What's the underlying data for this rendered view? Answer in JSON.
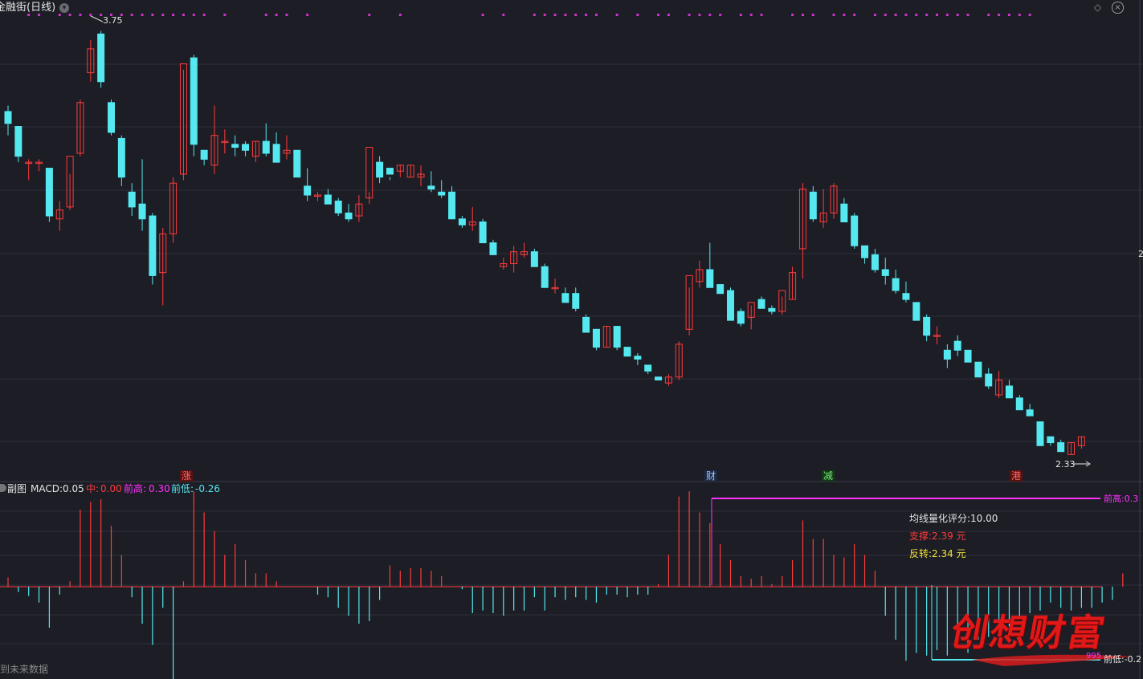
{
  "header": {
    "title": "金融街(日线)",
    "icons": [
      "dropdown-icon",
      "diamond-icon",
      "close-icon"
    ]
  },
  "price_panel": {
    "high_label": "3.75",
    "low_label": "2.33",
    "right_tick": "2",
    "event_tags": [
      {
        "text": "涨",
        "style": "red",
        "bar_index": 17
      },
      {
        "text": "财",
        "style": "blue",
        "bar_index": 68
      },
      {
        "text": "减",
        "style": "green",
        "bar_index": 79
      },
      {
        "text": "港",
        "style": "red",
        "bar_index": 97
      }
    ]
  },
  "sub_panel": {
    "name": "副图",
    "macd_label": "MACD:",
    "macd_value": "0.05",
    "mid_label": "中:",
    "mid_value": "0.00",
    "prev_high_label": "前高:",
    "prev_high_value": "0.30",
    "prev_low_label": "前低:",
    "prev_low_value": "-0.26",
    "score_text": "均线量化评分:10.00",
    "support_text": "支撑:2.39 元",
    "reversal_text": "反转:2.34 元",
    "prev_high_tag": "前高:0.3",
    "prev_low_tag": "前低:-0.2",
    "bottom_small": "995",
    "footer_text": "到未来数据"
  },
  "watermark": "创想财富",
  "colors": {
    "background": "#1c1d25",
    "up": "#ff3b3b",
    "down": "#55e8f0",
    "marker": "#cc33cc",
    "grid": "#2e303a"
  },
  "chart_data": [
    {
      "type": "candlestick",
      "title": "金融街(日线)",
      "ylim": [
        2.28,
        3.8
      ],
      "ohlc": [
        [
          3.48,
          3.5,
          3.4,
          3.44
        ],
        [
          3.43,
          3.43,
          3.31,
          3.33
        ],
        [
          3.31,
          3.32,
          3.25,
          3.31
        ],
        [
          3.31,
          3.32,
          3.28,
          3.31
        ],
        [
          3.29,
          3.29,
          3.11,
          3.13
        ],
        [
          3.12,
          3.18,
          3.08,
          3.15
        ],
        [
          3.16,
          3.27,
          3.15,
          3.33
        ],
        [
          3.34,
          3.52,
          3.33,
          3.51
        ],
        [
          3.61,
          3.72,
          3.58,
          3.69
        ],
        [
          3.74,
          3.75,
          3.56,
          3.58
        ],
        [
          3.51,
          3.52,
          3.4,
          3.41
        ],
        [
          3.39,
          3.4,
          3.23,
          3.26
        ],
        [
          3.21,
          3.24,
          3.13,
          3.16
        ],
        [
          3.17,
          3.32,
          3.08,
          3.12
        ],
        [
          3.13,
          3.14,
          2.9,
          2.93
        ],
        [
          2.94,
          3.09,
          2.83,
          3.07
        ],
        [
          3.07,
          3.26,
          3.04,
          3.24
        ],
        [
          3.27,
          3.62,
          3.25,
          3.64
        ],
        [
          3.66,
          3.67,
          3.33,
          3.37
        ],
        [
          3.35,
          3.35,
          3.3,
          3.32
        ],
        [
          3.3,
          3.5,
          3.27,
          3.4
        ],
        [
          3.38,
          3.42,
          3.34,
          3.38
        ],
        [
          3.37,
          3.4,
          3.33,
          3.36
        ],
        [
          3.37,
          3.38,
          3.33,
          3.35
        ],
        [
          3.33,
          3.38,
          3.31,
          3.38
        ],
        [
          3.38,
          3.44,
          3.33,
          3.34
        ],
        [
          3.37,
          3.41,
          3.31,
          3.31
        ],
        [
          3.34,
          3.4,
          3.32,
          3.35
        ],
        [
          3.35,
          3.35,
          3.28,
          3.26
        ],
        [
          3.23,
          3.29,
          3.18,
          3.2
        ],
        [
          3.2,
          3.21,
          3.18,
          3.2
        ],
        [
          3.2,
          3.22,
          3.17,
          3.17
        ],
        [
          3.18,
          3.19,
          3.13,
          3.14
        ],
        [
          3.14,
          3.17,
          3.11,
          3.12
        ],
        [
          3.13,
          3.2,
          3.11,
          3.17
        ],
        [
          3.19,
          3.21,
          3.17,
          3.36
        ],
        [
          3.31,
          3.33,
          3.24,
          3.26
        ],
        [
          3.29,
          3.26,
          3.25,
          3.27
        ],
        [
          3.28,
          3.3,
          3.26,
          3.3
        ],
        [
          3.26,
          3.3,
          3.26,
          3.3
        ],
        [
          3.26,
          3.3,
          3.23,
          3.27
        ],
        [
          3.23,
          3.28,
          3.21,
          3.22
        ],
        [
          3.21,
          3.25,
          3.19,
          3.2
        ],
        [
          3.21,
          3.23,
          3.15,
          3.12
        ],
        [
          3.12,
          3.13,
          3.09,
          3.1
        ],
        [
          3.1,
          3.16,
          3.08,
          3.11
        ],
        [
          3.11,
          3.12,
          3.06,
          3.04
        ],
        [
          3.04,
          3.05,
          3.01,
          3.0
        ],
        [
          2.96,
          2.99,
          2.95,
          2.97
        ],
        [
          2.97,
          3.03,
          2.94,
          3.01
        ],
        [
          3.0,
          3.04,
          2.99,
          3.01
        ],
        [
          3.01,
          3.02,
          2.96,
          2.96
        ],
        [
          2.96,
          2.97,
          2.9,
          2.89
        ],
        [
          2.89,
          2.92,
          2.87,
          2.89
        ],
        [
          2.87,
          2.89,
          2.86,
          2.84
        ],
        [
          2.87,
          2.89,
          2.81,
          2.82
        ],
        [
          2.79,
          2.8,
          2.75,
          2.74
        ],
        [
          2.75,
          2.75,
          2.68,
          2.69
        ],
        [
          2.69,
          2.76,
          2.69,
          2.76
        ],
        [
          2.76,
          2.76,
          2.68,
          2.69
        ],
        [
          2.69,
          2.69,
          2.67,
          2.66
        ],
        [
          2.66,
          2.67,
          2.63,
          2.65
        ],
        [
          2.63,
          2.63,
          2.6,
          2.61
        ],
        [
          2.59,
          2.59,
          2.58,
          2.58
        ],
        [
          2.57,
          2.6,
          2.56,
          2.59
        ],
        [
          2.59,
          2.71,
          2.58,
          2.7
        ],
        [
          2.75,
          2.89,
          2.73,
          2.93
        ],
        [
          2.91,
          2.98,
          2.89,
          2.95
        ],
        [
          2.95,
          3.04,
          2.89,
          2.89
        ],
        [
          2.9,
          2.9,
          2.87,
          2.87
        ],
        [
          2.88,
          2.89,
          2.78,
          2.78
        ],
        [
          2.81,
          2.82,
          2.76,
          2.77
        ],
        [
          2.79,
          2.83,
          2.75,
          2.84
        ],
        [
          2.85,
          2.86,
          2.82,
          2.82
        ],
        [
          2.82,
          2.83,
          2.8,
          2.81
        ],
        [
          2.81,
          2.86,
          2.8,
          2.88
        ],
        [
          2.85,
          2.96,
          2.85,
          2.94
        ],
        [
          3.02,
          3.24,
          2.92,
          3.22
        ],
        [
          3.21,
          3.23,
          3.11,
          3.12
        ],
        [
          3.11,
          3.22,
          3.09,
          3.14
        ],
        [
          3.14,
          3.24,
          3.12,
          3.23
        ],
        [
          3.17,
          3.19,
          3.12,
          3.11
        ],
        [
          3.13,
          3.14,
          3.02,
          3.03
        ],
        [
          3.03,
          3.03,
          2.97,
          2.99
        ],
        [
          3.0,
          3.02,
          2.94,
          2.95
        ],
        [
          2.95,
          2.99,
          2.9,
          2.93
        ],
        [
          2.92,
          2.95,
          2.87,
          2.88
        ],
        [
          2.87,
          2.91,
          2.84,
          2.85
        ],
        [
          2.84,
          2.84,
          2.8,
          2.78
        ],
        [
          2.79,
          2.8,
          2.71,
          2.73
        ],
        [
          2.73,
          2.76,
          2.7,
          2.73
        ],
        [
          2.68,
          2.7,
          2.62,
          2.65
        ],
        [
          2.71,
          2.73,
          2.66,
          2.68
        ],
        [
          2.68,
          2.68,
          2.64,
          2.64
        ],
        [
          2.64,
          2.64,
          2.6,
          2.59
        ],
        [
          2.6,
          2.62,
          2.55,
          2.56
        ],
        [
          2.53,
          2.61,
          2.52,
          2.58
        ],
        [
          2.56,
          2.58,
          2.53,
          2.52
        ],
        [
          2.52,
          2.53,
          2.48,
          2.48
        ],
        [
          2.48,
          2.5,
          2.46,
          2.46
        ],
        [
          2.44,
          2.44,
          2.38,
          2.36
        ],
        [
          2.39,
          2.39,
          2.36,
          2.37
        ],
        [
          2.37,
          2.38,
          2.34,
          2.34
        ],
        [
          2.33,
          2.37,
          2.33,
          2.37
        ],
        [
          2.36,
          2.39,
          2.35,
          2.39
        ]
      ]
    },
    {
      "type": "bar",
      "title": "MACD",
      "ylim": [
        -0.3,
        0.33
      ],
      "values": [
        0.035,
        -0.02,
        -0.035,
        -0.06,
        -0.155,
        -0.03,
        0.02,
        0.29,
        0.32,
        0.33,
        0.23,
        0.12,
        -0.04,
        -0.14,
        -0.22,
        -0.08,
        -0.41,
        0.02,
        0.36,
        0.28,
        0.21,
        0.12,
        0.16,
        0.1,
        0.05,
        0.05,
        0.02,
        0.0,
        0.0,
        0.0,
        -0.03,
        -0.04,
        -0.08,
        -0.11,
        -0.14,
        -0.13,
        -0.05,
        0.08,
        0.06,
        0.07,
        0.07,
        0.06,
        0.04,
        0.0,
        -0.01,
        -0.1,
        -0.09,
        -0.1,
        -0.11,
        -0.09,
        -0.09,
        -0.04,
        -0.09,
        -0.04,
        -0.05,
        -0.04,
        -0.05,
        -0.06,
        -0.03,
        -0.03,
        -0.04,
        -0.03,
        -0.03,
        0.01,
        0.12,
        0.34,
        0.36,
        0.28,
        0.24,
        0.16,
        0.1,
        0.04,
        0.03,
        0.04,
        0.01,
        0.04,
        0.1,
        0.25,
        0.18,
        0.18,
        0.12,
        0.11,
        0.16,
        0.12,
        0.06,
        -0.11,
        -0.2,
        -0.28,
        -0.25,
        -0.26,
        -0.24,
        -0.26,
        -0.22,
        -0.25,
        -0.2,
        -0.19,
        -0.17,
        -0.15,
        -0.12,
        -0.1,
        -0.09,
        -0.06,
        -0.08,
        -0.09,
        -0.08,
        -0.08,
        -0.06,
        -0.05,
        0.05
      ]
    }
  ]
}
